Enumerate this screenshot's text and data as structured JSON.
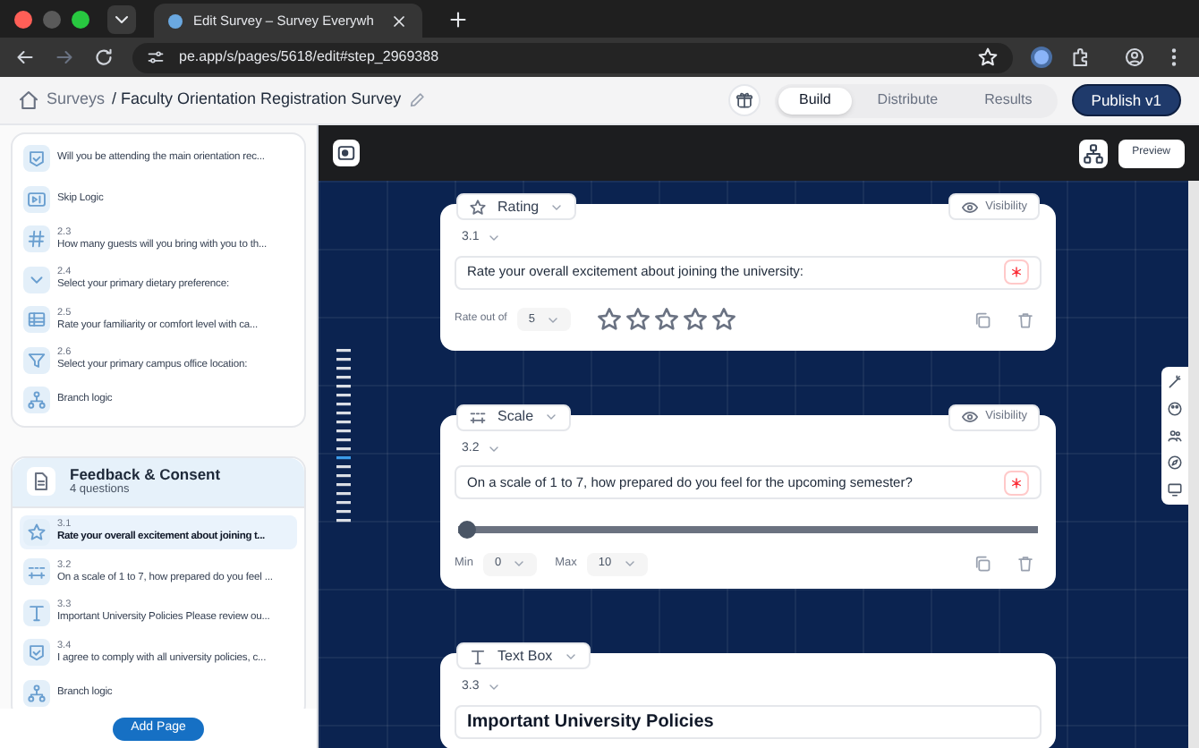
{
  "browser": {
    "tab_title": "Edit Survey – Survey Everywh",
    "url": "pe.app/s/pages/5618/edit#step_2969388"
  },
  "header": {
    "root": "Surveys",
    "title": "/ Faculty Orientation Registration Survey",
    "tabs": [
      {
        "label": "Build",
        "selected": true
      },
      {
        "label": "Distribute",
        "selected": false
      },
      {
        "label": "Results",
        "selected": false
      }
    ],
    "publish": "Publish v1"
  },
  "sidebar": {
    "sections": [
      {
        "items": [
          {
            "kind": "question",
            "text": "Will you be attending the main orientation rec...",
            "selected": false
          },
          {
            "kind": "skip",
            "text": "Skip Logic",
            "selected": false
          },
          {
            "kind": "number",
            "number": "2.3",
            "text": "How many guests will you bring with you to th...",
            "selected": false
          },
          {
            "kind": "dropdown",
            "number": "2.4",
            "text": "Select your primary dietary preference:",
            "selected": false
          },
          {
            "kind": "matrix",
            "number": "2.5",
            "text": "Rate your familiarity or comfort level with ca...",
            "selected": false
          },
          {
            "kind": "funnel",
            "number": "2.6",
            "text": "Select your primary campus office location:",
            "selected": false
          },
          {
            "kind": "branch",
            "text": "Branch logic",
            "selected": false
          }
        ]
      },
      {
        "title": "Feedback & Consent",
        "subtitle": "4 questions",
        "items": [
          {
            "kind": "rating",
            "number": "3.1",
            "text": "Rate your overall excitement about joining t...",
            "selected": true
          },
          {
            "kind": "scale",
            "number": "3.2",
            "text": "On a scale of 1 to 7, how prepared do you feel ...",
            "selected": false
          },
          {
            "kind": "text",
            "number": "3.3",
            "text": "Important University Policies Please review ou...",
            "selected": false
          },
          {
            "kind": "consent",
            "number": "3.4",
            "text": "I agree to comply with all university policies, c...",
            "selected": false
          },
          {
            "kind": "branch",
            "text": "Branch logic",
            "selected": false
          }
        ]
      }
    ],
    "add_page": "Add Page"
  },
  "canvas": {
    "preview": "Preview",
    "questions": [
      {
        "kind": "rating",
        "type_label": "Rating",
        "visibility": "Visibility",
        "number": "3.1",
        "text": "Rate your overall excitement about joining the university:",
        "required": true,
        "rate_label": "Rate out of",
        "rate_value": "5",
        "stars": 0
      },
      {
        "kind": "scale",
        "type_label": "Scale",
        "visibility": "Visibility",
        "number": "3.2",
        "text": "On a scale of 1 to 7, how prepared do you feel for the upcoming semester?",
        "required": true,
        "level": 0,
        "min_label": "Min",
        "min_value": "0",
        "max_label": "Max",
        "max_value": "10"
      },
      {
        "kind": "text",
        "type_label": "Text Box",
        "number": "3.3",
        "text": "Important University Policies"
      }
    ]
  }
}
